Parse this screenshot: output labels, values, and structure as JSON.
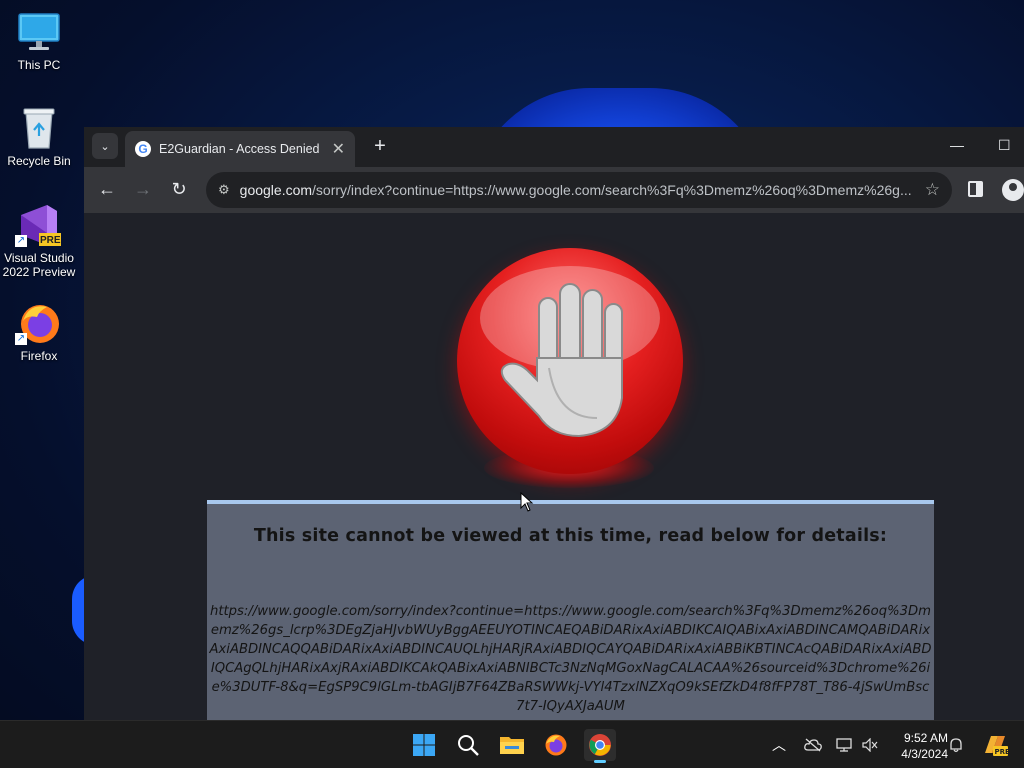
{
  "desktop": {
    "icons": [
      {
        "label": "This PC",
        "icon": "monitor-icon"
      },
      {
        "label": "Recycle Bin",
        "icon": "recycle-bin-icon"
      },
      {
        "label": "Visual Studio 2022 Preview",
        "icon": "visual-studio-icon",
        "badge": "PRE"
      },
      {
        "label": "Firefox",
        "icon": "firefox-icon"
      }
    ]
  },
  "browser": {
    "tab": {
      "title": "E2Guardian - Access Denied",
      "favicon": "G"
    },
    "address": {
      "host": "google.com",
      "path": "/sorry/index?continue=https://www.google.com/search%3Fq%3Dmemz%26oq%3Dmemz%26g..."
    }
  },
  "page": {
    "heading": "This site cannot be viewed at this time, read below for details:",
    "blocked_url": "https://www.google.com/sorry/index?continue=https://www.google.com/search%3Fq%3Dmemz%26oq%3Dmemz%26gs_lcrp%3DEgZjaHJvbWUyBggAEEUYOTINCAEQABiDARixAxiABDIKCAIQABixAxiABDINCAMQABiDARixAxiABDINCAQQABiDARixAxiABDINCAUQLhjHARjRAxiABDIQCAYQABiDARixAxiABBiKBTINCAcQABiDARixAxiABDIQCAgQLhjHARixAxjRAxiABDIKCAkQABixAxiABNIBCTc3NzNqMGoxNagCALACAA%26sourceid%3Dchrome%26ie%3DUTF-8&q=EgSP9C9lGLm-tbAGIjB7F64ZBaRSWWkj-VYl4TzxlNZXqO9kSEfZkD4f8fFP78T_T86-4jSwUmBsc7t7-IQyAXJaAUM"
  },
  "taskbar": {
    "time": "9:52 AM",
    "date": "4/3/2024",
    "pinned": [
      "start-icon",
      "search-icon",
      "file-explorer-icon",
      "firefox-icon",
      "chrome-icon"
    ]
  },
  "colors": {
    "accent": "#60cdff",
    "stop_red": "#e52020",
    "panel": "#5c6373",
    "panel_border": "#a8c8ee"
  }
}
